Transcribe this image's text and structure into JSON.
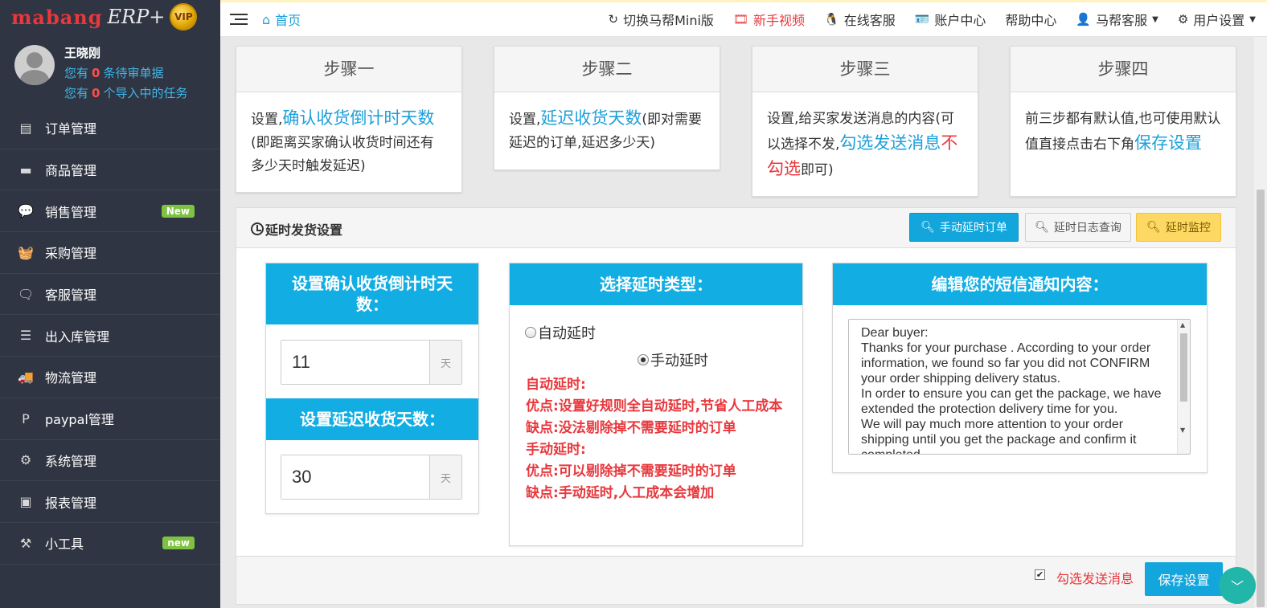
{
  "sidebar": {
    "logo_brand": "mabang",
    "logo_erp": "ERP+",
    "logo_vip": "VIP",
    "user_name": "王晓刚",
    "pending_prefix": "您有",
    "pending_count": "0",
    "pending_suffix": "条待审单据",
    "import_prefix": "您有",
    "import_count": "0",
    "import_suffix": "个导入中的任务",
    "items": [
      {
        "label": "订单管理",
        "icon": "order-icon",
        "glyph": "▤"
      },
      {
        "label": "商品管理",
        "icon": "goods-icon",
        "glyph": "▬"
      },
      {
        "label": "销售管理",
        "icon": "chat-icon",
        "glyph": "💬",
        "badge": "New"
      },
      {
        "label": "采购管理",
        "icon": "basket-icon",
        "glyph": "🧺"
      },
      {
        "label": "客服管理",
        "icon": "comment-icon",
        "glyph": "🗨"
      },
      {
        "label": "出入库管理",
        "icon": "warehouse-icon",
        "glyph": "☰"
      },
      {
        "label": "物流管理",
        "icon": "truck-icon",
        "glyph": "🚚"
      },
      {
        "label": "paypal管理",
        "icon": "paypal-icon",
        "glyph": "P"
      },
      {
        "label": "系统管理",
        "icon": "gear-icon",
        "glyph": "⚙"
      },
      {
        "label": "报表管理",
        "icon": "report-icon",
        "glyph": "▣"
      },
      {
        "label": "小工具",
        "icon": "tools-icon",
        "glyph": "⚒",
        "badge": "new"
      }
    ]
  },
  "topbar": {
    "home": "首页",
    "links": [
      {
        "label": "切换马帮Mini版",
        "icon": "refresh-icon",
        "glyph": "↻"
      },
      {
        "label": "新手视频",
        "icon": "film-icon",
        "glyph": "🎞",
        "red": true
      },
      {
        "label": "在线客服",
        "icon": "qq-icon",
        "glyph": "🐧"
      },
      {
        "label": "账户中心",
        "icon": "card-icon",
        "glyph": "🪪"
      },
      {
        "label": "帮助中心",
        "icon": "",
        "glyph": ""
      },
      {
        "label": "马帮客服",
        "icon": "user-icon",
        "glyph": "👤",
        "caret": true
      },
      {
        "label": "用户设置",
        "icon": "gear-icon",
        "glyph": "⚙",
        "caret": true
      }
    ]
  },
  "steps": [
    {
      "title": "步骤一",
      "text1": "设置,",
      "hl": "确认收货倒计时天数",
      "text2": "(即距离买家确认收货时间还有多少天时触发延迟)"
    },
    {
      "title": "步骤二",
      "text1": "设置,",
      "hl": "延迟收货天数",
      "text2": "(即对需要延迟的订单,延迟多少天)"
    },
    {
      "title": "步骤三",
      "text1": "设置,给买家发送消息的内容(可以选择不发,",
      "hl": "勾选发送消息",
      "hlred": "不勾选",
      "text2": "即可)"
    },
    {
      "title": "步骤四",
      "text1": "前三步都有默认值,也可使用默认值直接点击右下角",
      "hl": "保存设置",
      "text2": ""
    }
  ],
  "panel": {
    "title": "延时发货设置",
    "btn_manual": "手动延时订单",
    "btn_log": "延时日志查询",
    "btn_monitor": "延时监控",
    "countdown_title": "设置确认收货倒计时天数：",
    "countdown_value": "11",
    "unit": "天",
    "delay_title": "设置延迟收货天数：",
    "delay_value": "30",
    "type_title": "选择延时类型：",
    "radio_auto": "自动延时",
    "radio_manual": "手动延时",
    "selected_type": "手动延时",
    "desc_lines": [
      "自动延时:",
      "优点:设置好规则全自动延时,节省人工成本",
      "缺点:没法剔除掉不需要延时的订单",
      "手动延时:",
      "优点:可以剔除掉不需要延时的订单",
      "缺点:手动延时,人工成本会增加"
    ],
    "sms_title": "编辑您的短信通知内容：",
    "sms_text": "Dear buyer:\nThanks for your purchase . According to your order information, we found so far you did not CONFIRM your order shipping delivery status.\nIn order to ensure you can get the package, we have extended the protection delivery time for you.\nWe will pay much more attention to your order shipping until you get the package and confirm it completed.",
    "send_msg_label": "勾选发送消息",
    "send_msg_checked": true,
    "save": "保存设置"
  }
}
